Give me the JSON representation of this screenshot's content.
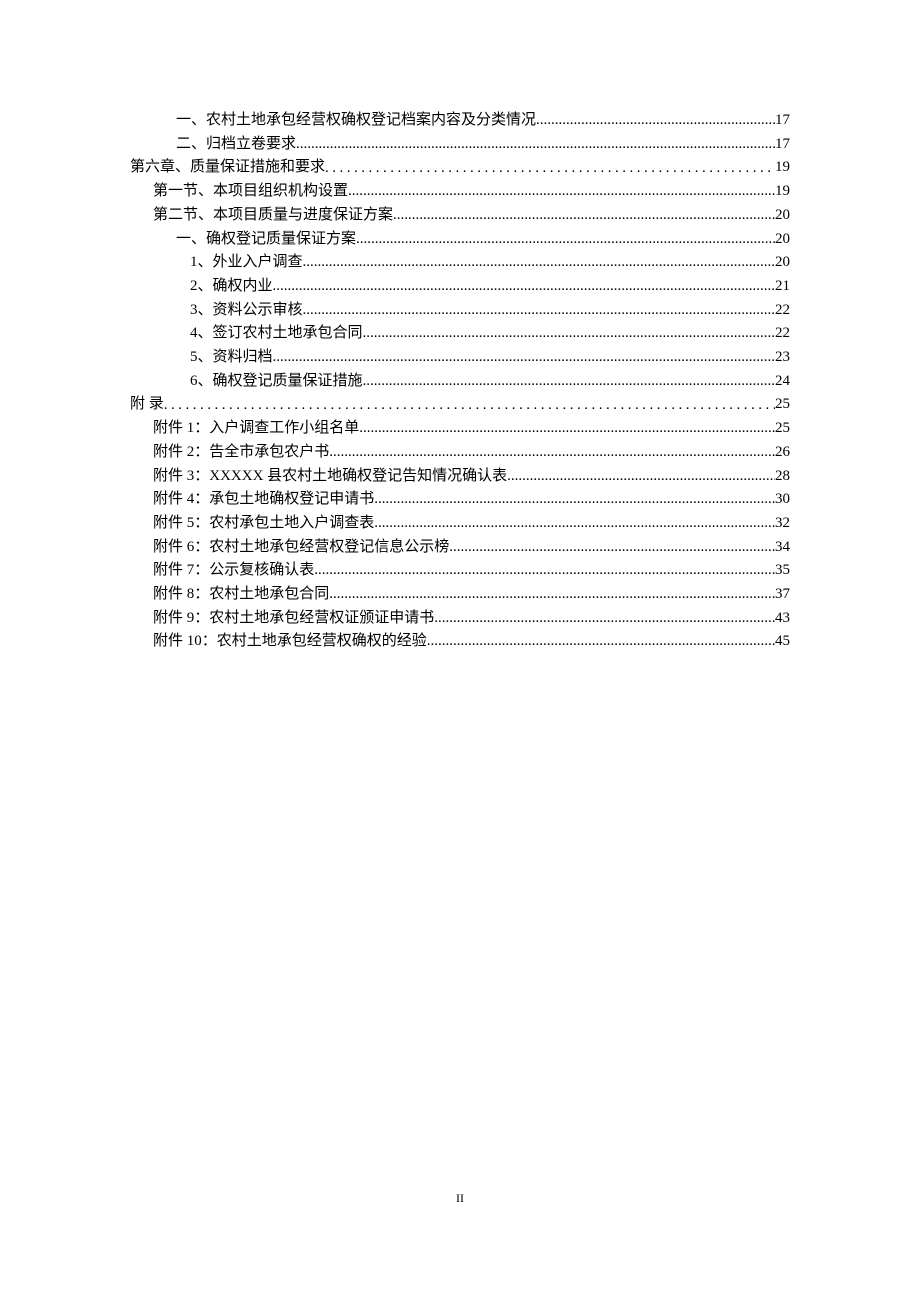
{
  "toc": [
    {
      "level": 3,
      "label": "一、农村土地承包经营权确权登记档案内容及分类情况",
      "page": "17",
      "wide": false
    },
    {
      "level": 3,
      "label": "二、归档立卷要求 ",
      "page": "17",
      "wide": false
    },
    {
      "level": 1,
      "label": "第六章、质量保证措施和要求",
      "page": " 19",
      "wide": true
    },
    {
      "level": 2,
      "label": "第一节、本项目组织机构设置",
      "page": "19",
      "wide": false
    },
    {
      "level": 2,
      "label": "第二节、本项目质量与进度保证方案",
      "page": "20",
      "wide": false
    },
    {
      "level": 3,
      "label": "一、确权登记质量保证方案",
      "page": "20",
      "wide": false
    },
    {
      "level": 4,
      "label": "1、外业入户调查 ",
      "page": "20",
      "wide": false
    },
    {
      "level": 4,
      "label": "2、确权内业 ",
      "page": "21",
      "wide": false
    },
    {
      "level": 4,
      "label": "3、资料公示审核 ",
      "page": "22",
      "wide": false
    },
    {
      "level": 4,
      "label": "4、签订农村土地承包合同",
      "page": "22",
      "wide": false
    },
    {
      "level": 4,
      "label": "5、资料归档 ",
      "page": "23",
      "wide": false
    },
    {
      "level": 4,
      "label": "6、确权登记质量保证措施",
      "page": "24",
      "wide": false
    },
    {
      "level": 1,
      "label": "附 录",
      "page": " 25",
      "wide": true
    },
    {
      "level": 2,
      "label": "附件 1：入户调查工作小组名单",
      "page": "25",
      "wide": false
    },
    {
      "level": 2,
      "label": "附件 2：告全市承包农户书 ",
      "page": "26",
      "wide": false
    },
    {
      "level": 2,
      "label": "附件 3：XXXXX 县农村土地确权登记告知情况确认表 ",
      "page": "28",
      "wide": false
    },
    {
      "level": 2,
      "label": "附件 4：承包土地确权登记申请书",
      "page": "30",
      "wide": false
    },
    {
      "level": 2,
      "label": "附件 5：农村承包土地入户调查表",
      "page": "32",
      "wide": false
    },
    {
      "level": 2,
      "label": "附件 6：农村土地承包经营权登记信息公示榜",
      "page": "34",
      "wide": false
    },
    {
      "level": 2,
      "label": "附件 7：公示复核确认表 ",
      "page": "35",
      "wide": false
    },
    {
      "level": 2,
      "label": "附件 8：农村土地承包合同 ",
      "page": "37",
      "wide": false
    },
    {
      "level": 2,
      "label": "附件 9：农村土地承包经营权证颁证申请书",
      "page": "43",
      "wide": false
    },
    {
      "level": 2,
      "label": "附件 10：农村土地承包经营权确权的经验",
      "page": "45",
      "wide": false
    }
  ],
  "page_number": "II"
}
